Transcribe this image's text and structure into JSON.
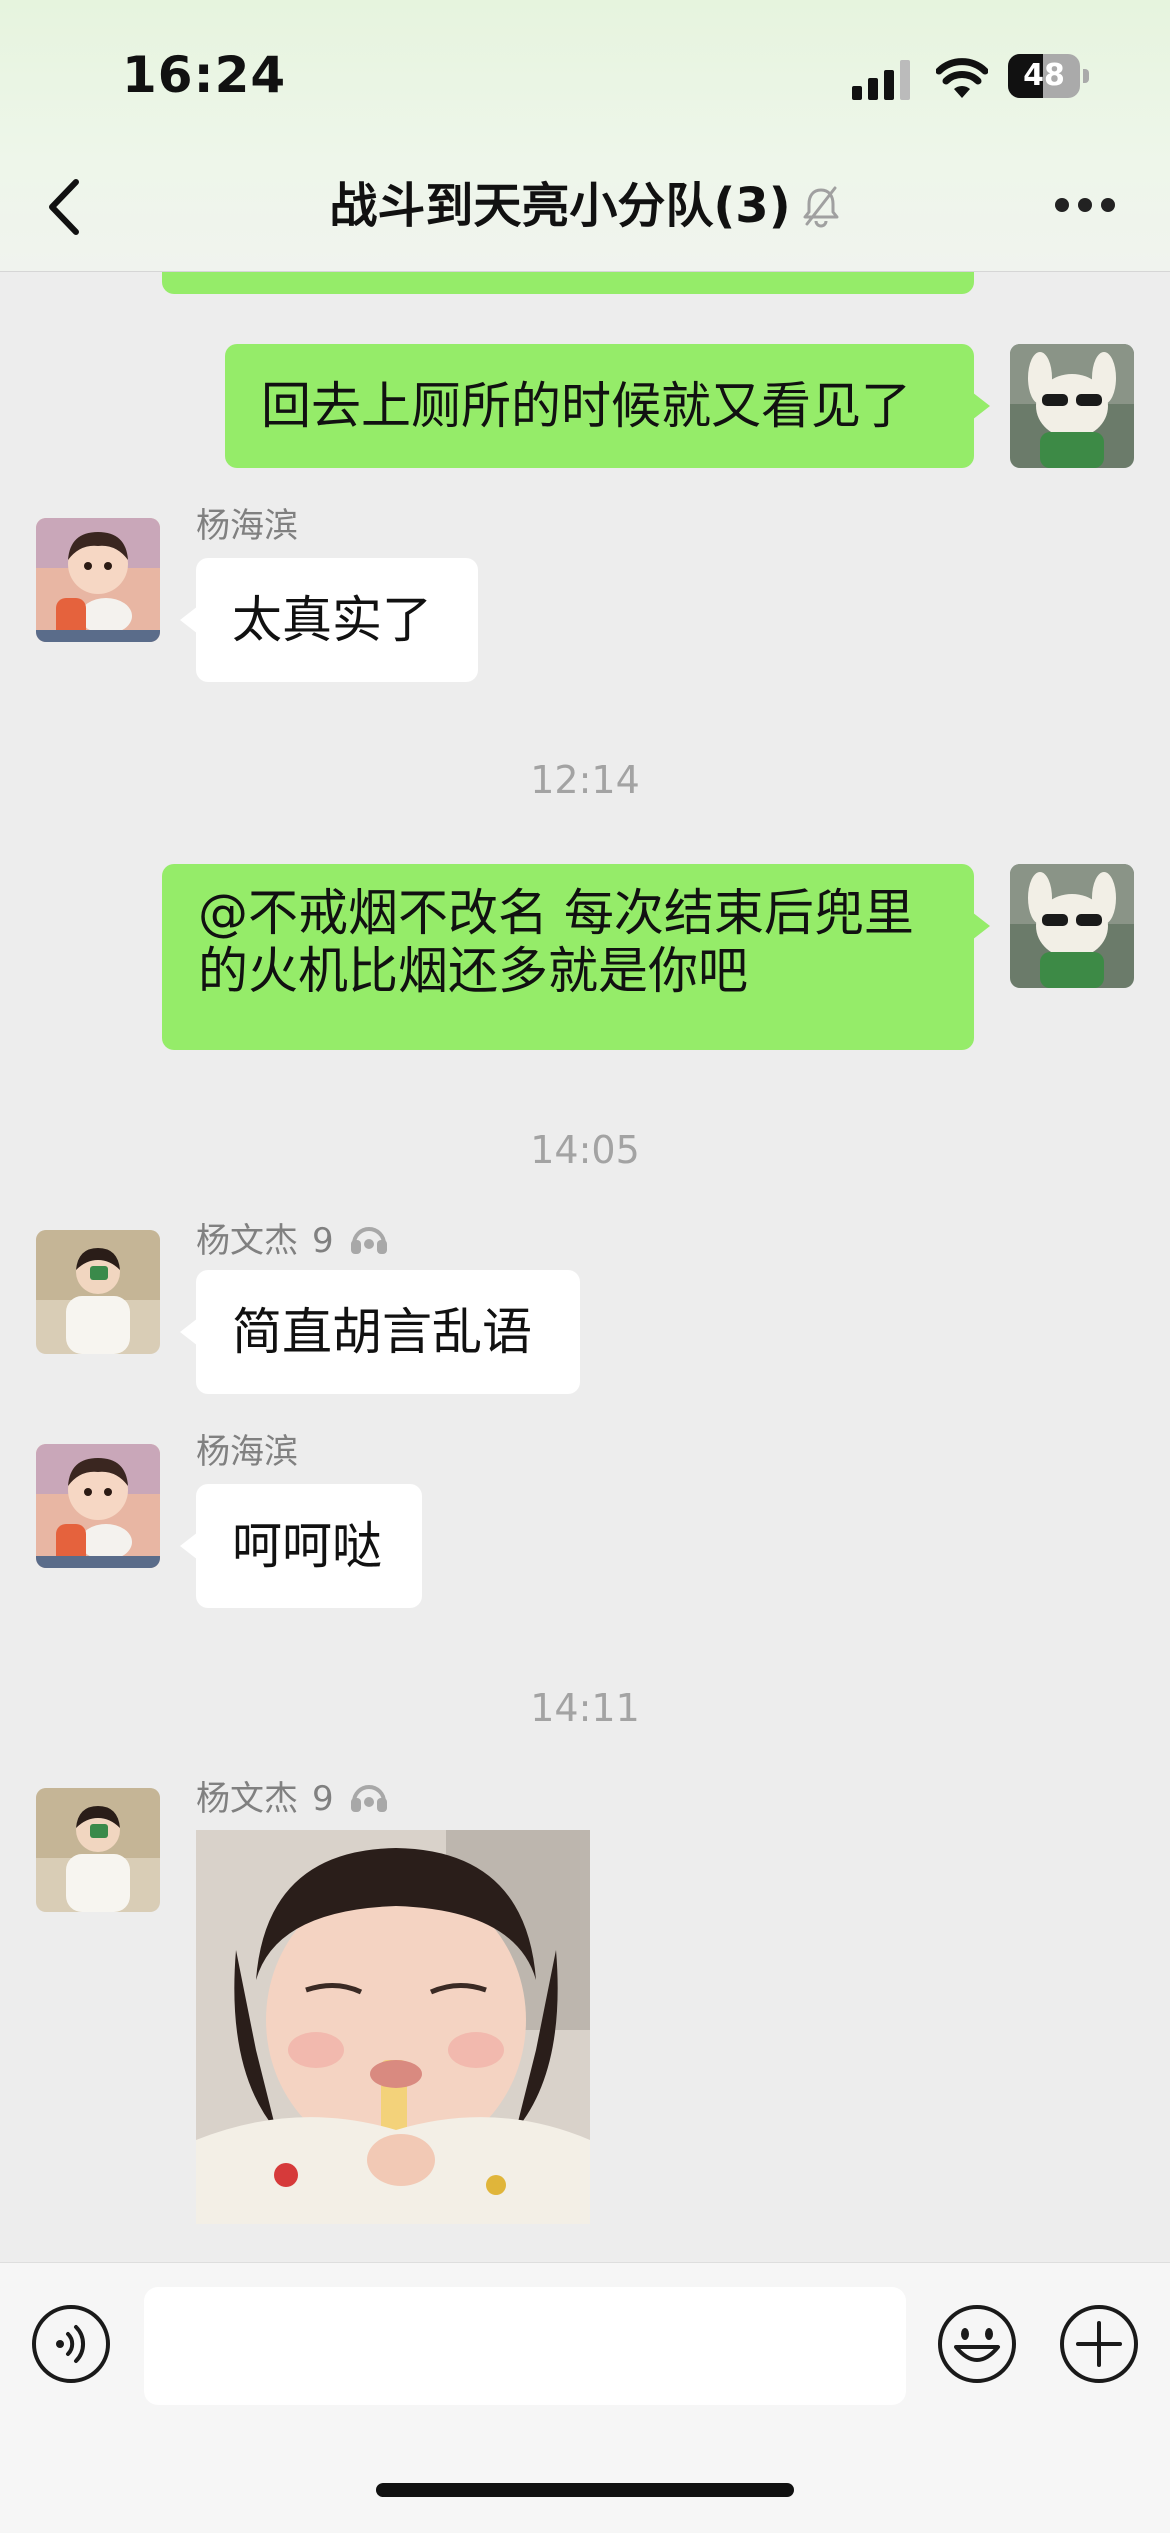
{
  "status_bar": {
    "time": "16:24",
    "battery_level": "48"
  },
  "header": {
    "title": "战斗到天亮小分队(3)",
    "muted": true
  },
  "messages": [
    {
      "type": "outgoing",
      "text": "回去上厕所的时候就又看见了"
    },
    {
      "type": "incoming",
      "sender": "杨海滨",
      "text": "太真实了"
    },
    {
      "type": "timestamp",
      "text": "12:14"
    },
    {
      "type": "outgoing",
      "text_line1": "@不戒烟不改名 每次结束后兜里",
      "text_line2": "的火机比烟还多就是你吧"
    },
    {
      "type": "timestamp",
      "text": "14:05"
    },
    {
      "type": "incoming",
      "sender": "杨文杰",
      "level": "9",
      "text": "简直胡言乱语"
    },
    {
      "type": "incoming",
      "sender": "杨海滨",
      "text": "呵呵哒"
    },
    {
      "type": "timestamp",
      "text": "14:11"
    },
    {
      "type": "incoming-image",
      "sender": "杨文杰",
      "level": "9"
    }
  ],
  "input": {
    "placeholder": ""
  },
  "colors": {
    "outgoing_bubble": "#95ec69",
    "incoming_bubble": "#ffffff",
    "background": "#ededed"
  }
}
